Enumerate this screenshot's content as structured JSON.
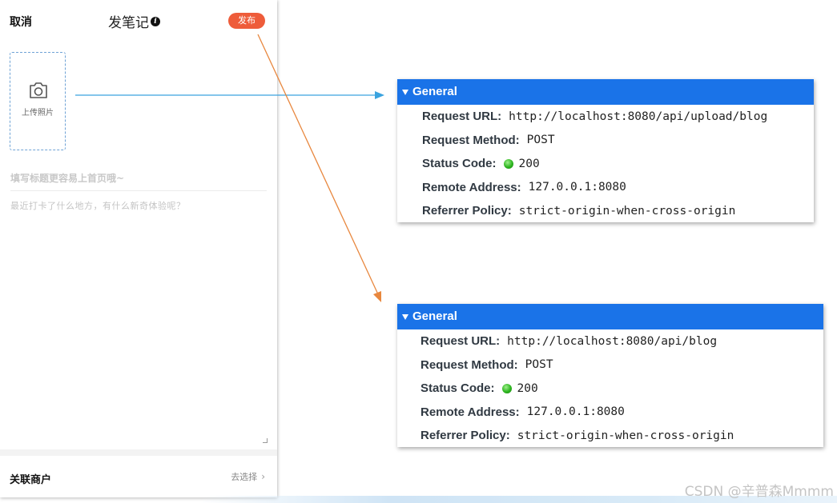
{
  "editor": {
    "cancel_label": "取消",
    "title": "发笔记",
    "publish_label": "发布",
    "upload_label": "上传照片",
    "title_placeholder": "填写标题更容易上首页哦~",
    "content_placeholder": "最近打卡了什么地方，有什么新奇体验呢？",
    "merchant_label": "关联商户",
    "merchant_action": "去选择"
  },
  "requests": [
    {
      "header": "General",
      "rows": [
        {
          "key": "Request URL:",
          "value": "http://localhost:8080/api/upload/blog"
        },
        {
          "key": "Request Method:",
          "value": "POST"
        },
        {
          "key": "Status Code:",
          "value": "200"
        },
        {
          "key": "Remote Address:",
          "value": "127.0.0.1:8080"
        },
        {
          "key": "Referrer Policy:",
          "value": "strict-origin-when-cross-origin"
        }
      ]
    },
    {
      "header": "General",
      "rows": [
        {
          "key": "Request URL:",
          "value": "http://localhost:8080/api/blog"
        },
        {
          "key": "Request Method:",
          "value": "POST"
        },
        {
          "key": "Status Code:",
          "value": "200"
        },
        {
          "key": "Remote Address:",
          "value": "127.0.0.1:8080"
        },
        {
          "key": "Referrer Policy:",
          "value": "strict-origin-when-cross-origin"
        }
      ]
    }
  ],
  "watermark": "CSDN @辛普森Mmmm",
  "colors": {
    "publish": "#ee5c3a",
    "header_blue": "#1a73e8",
    "arrow_blue": "#3aa3df",
    "arrow_orange": "#e8873e",
    "status_green": "#2db51f"
  },
  "icons": {
    "camera": "camera-icon",
    "info": "info-icon",
    "chevron": "chevron-right-icon",
    "triangle": "triangle-down-icon"
  }
}
